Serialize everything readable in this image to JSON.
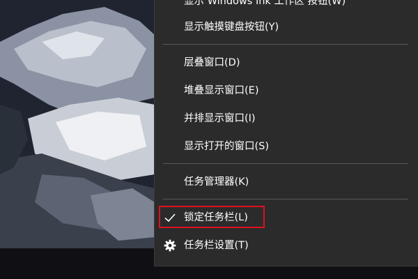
{
  "context_menu": {
    "items": [
      {
        "label": "显示 Windows Ink 工作区 按钮(W)"
      },
      {
        "label": "显示触摸键盘按钮(Y)"
      },
      {
        "label": "层叠窗口(D)"
      },
      {
        "label": "堆叠显示窗口(E)"
      },
      {
        "label": "并排显示窗口(I)"
      },
      {
        "label": "显示打开的窗口(S)"
      },
      {
        "label": "任务管理器(K)"
      },
      {
        "label": "锁定任务栏(L)",
        "checked": true,
        "icon": "checkmark-icon"
      },
      {
        "label": "任务栏设置(T)",
        "icon": "gear-icon"
      }
    ]
  },
  "colors": {
    "menu_background": "#2b2b2b",
    "menu_text": "#ffffff",
    "separator": "#5a5a5a",
    "highlight_border": "#e01020",
    "taskbar": "#101014"
  }
}
